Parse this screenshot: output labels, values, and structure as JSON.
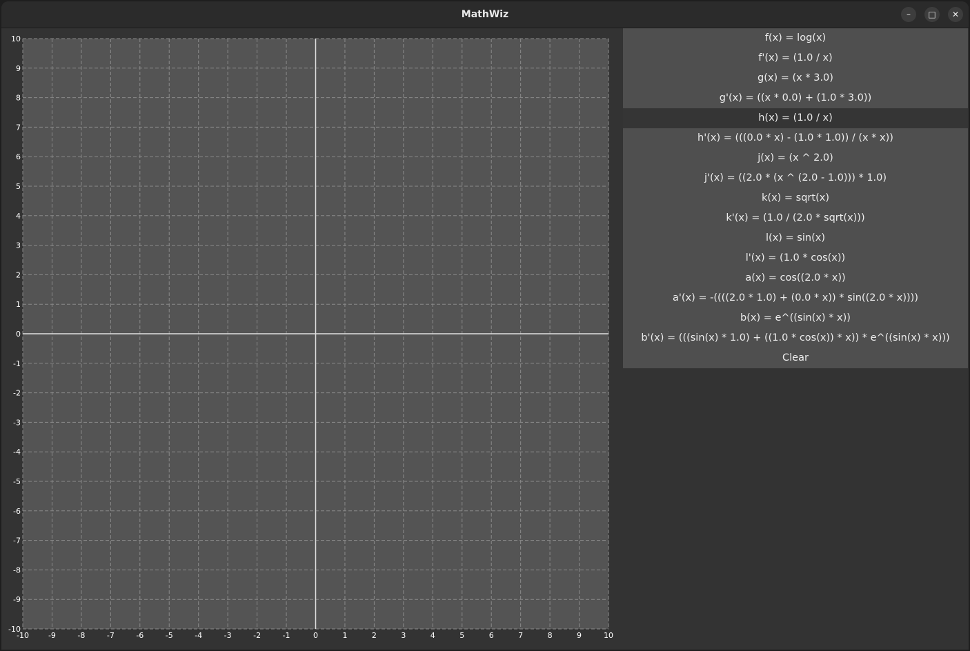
{
  "window": {
    "title": "MathWiz",
    "controls": {
      "minimize": "–",
      "maximize": "□",
      "close": "✕"
    }
  },
  "functions": [
    {
      "label": "f(x) = log(x)",
      "selected": false
    },
    {
      "label": "f'(x) = (1.0 / x)",
      "selected": false
    },
    {
      "label": "g(x) = (x * 3.0)",
      "selected": false
    },
    {
      "label": "g'(x) = ((x * 0.0) + (1.0 * 3.0))",
      "selected": false
    },
    {
      "label": "h(x) = (1.0 / x)",
      "selected": true
    },
    {
      "label": "h'(x) = (((0.0 * x) - (1.0 * 1.0)) / (x * x))",
      "selected": false
    },
    {
      "label": "j(x) = (x ^ 2.0)",
      "selected": false
    },
    {
      "label": "j'(x) = ((2.0 * (x ^ (2.0 - 1.0))) * 1.0)",
      "selected": false
    },
    {
      "label": "k(x) = sqrt(x)",
      "selected": false
    },
    {
      "label": "k'(x) = (1.0 / (2.0 * sqrt(x)))",
      "selected": false
    },
    {
      "label": "l(x) = sin(x)",
      "selected": false
    },
    {
      "label": "l'(x) = (1.0 * cos(x))",
      "selected": false
    },
    {
      "label": "a(x) = cos((2.0 * x))",
      "selected": false
    },
    {
      "label": "a'(x) = -((((2.0 * 1.0) + (0.0 * x)) * sin((2.0 * x))))",
      "selected": false
    },
    {
      "label": "b(x) = e^((sin(x) * x))",
      "selected": false
    },
    {
      "label": "b'(x) = (((sin(x) * 1.0) + ((1.0 * cos(x)) * x)) * e^((sin(x) * x)))",
      "selected": false
    }
  ],
  "clear_label": "Clear",
  "graph": {
    "xlim": [
      -10,
      10
    ],
    "ylim": [
      -10,
      10
    ],
    "tick_step": 1,
    "grid": true,
    "grid_style": "dashed",
    "colors": {
      "background": "#545454",
      "grid": "#8a8a8a",
      "axes": "#e0e0e0",
      "tick_text": "#ffffff"
    }
  }
}
